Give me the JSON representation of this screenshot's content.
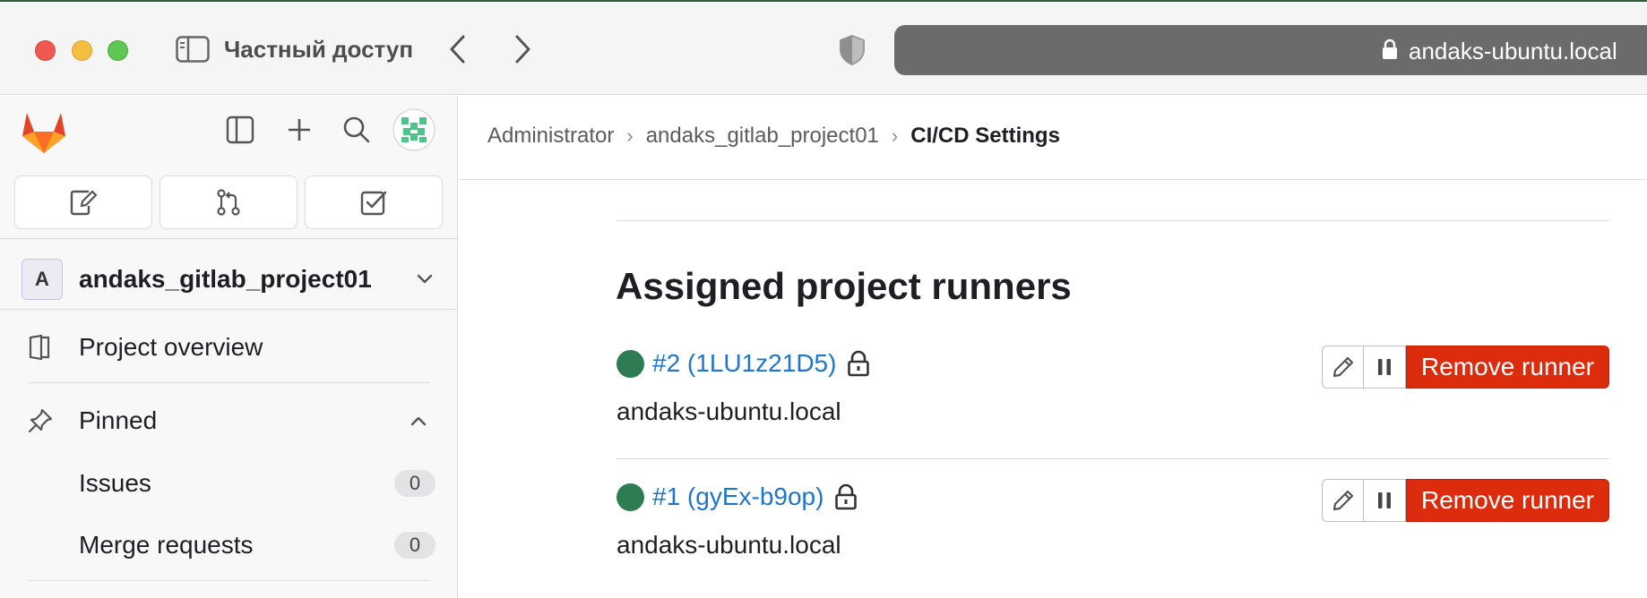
{
  "browser": {
    "tab_title": "Частный доступ",
    "url": "andaks-ubuntu.local"
  },
  "sidebar": {
    "project_initial": "A",
    "project_name": "andaks_gitlab_project01",
    "items": [
      {
        "label": "Project overview"
      },
      {
        "label": "Pinned"
      }
    ],
    "pinned": [
      {
        "label": "Issues",
        "count": "0"
      },
      {
        "label": "Merge requests",
        "count": "0"
      }
    ]
  },
  "breadcrumbs": [
    "Administrator",
    "andaks_gitlab_project01",
    "CI/CD Settings"
  ],
  "main": {
    "section_title": "Assigned project runners",
    "runners": [
      {
        "id_label": "#2 (1LU1z21D5)",
        "host": "andaks-ubuntu.local",
        "status_color": "#2e7d52",
        "remove_label": "Remove runner"
      },
      {
        "id_label": "#1 (gyEx-b9op)",
        "host": "andaks-ubuntu.local",
        "status_color": "#2e7d52",
        "remove_label": "Remove runner"
      }
    ]
  },
  "colors": {
    "link": "#1f75cb",
    "danger": "#dd2b0e",
    "status_online": "#2e7d52"
  }
}
